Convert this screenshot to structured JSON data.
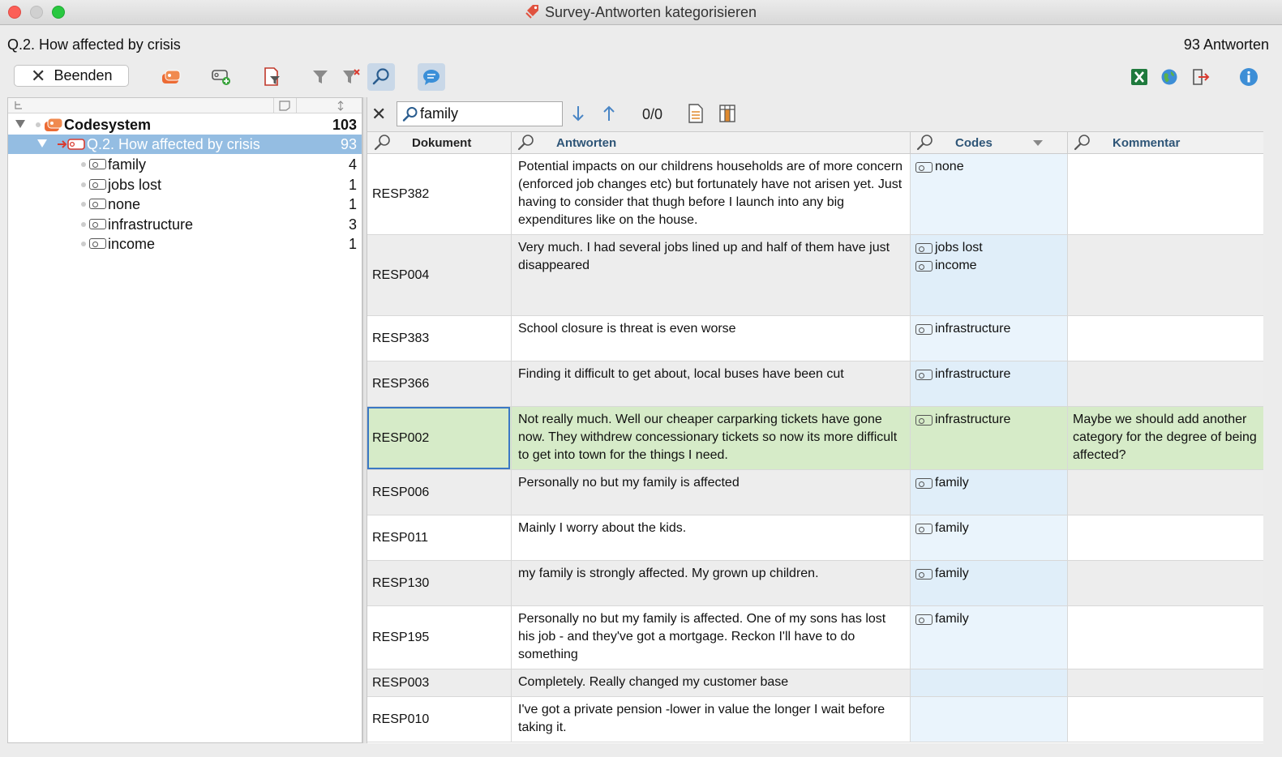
{
  "window": {
    "title": "Survey-Antworten kategorisieren"
  },
  "header": {
    "question": "Q.2. How affected by crisis",
    "answer_count": "93 Antworten"
  },
  "toolbar": {
    "quit_label": "Beenden",
    "icons": [
      "code-system-icon",
      "new-code-icon",
      "filter-document-icon",
      "filter-icon",
      "clear-filter-icon",
      "search-icon",
      "comment-icon",
      "excel-export-icon",
      "web-export-icon",
      "exit-export-icon",
      "info-icon"
    ]
  },
  "tree": {
    "root": {
      "label": "Codesystem",
      "count": "103"
    },
    "question": {
      "label": "Q.2. How affected by crisis",
      "count": "93"
    },
    "codes": [
      {
        "label": "family",
        "count": "4"
      },
      {
        "label": "jobs lost",
        "count": "1"
      },
      {
        "label": "none",
        "count": "1"
      },
      {
        "label": "infrastructure",
        "count": "3"
      },
      {
        "label": "income",
        "count": "1"
      }
    ]
  },
  "search": {
    "value": "family",
    "hits": "0/0"
  },
  "table": {
    "columns": {
      "doc": "Dokument",
      "answers": "Antworten",
      "codes": "Codes",
      "comment": "Kommentar"
    },
    "rows": [
      {
        "doc": "RESP382",
        "answer": "Potential impacts on our childrens households are of more concern (enforced job changes etc) but fortunately have not arisen yet. Just having to consider that thugh before I launch into any big expenditures like on the house.",
        "codes": [
          "none"
        ],
        "comment": ""
      },
      {
        "doc": "RESP004",
        "answer": "Very much. I had several jobs lined up and half of them have just disappeared",
        "codes": [
          "jobs lost",
          "income"
        ],
        "comment": ""
      },
      {
        "doc": "RESP383",
        "answer": "School closure is threat is even worse",
        "codes": [
          "infrastructure"
        ],
        "comment": ""
      },
      {
        "doc": "RESP366",
        "answer": "Finding it difficult to get about, local buses have been cut",
        "codes": [
          "infrastructure"
        ],
        "comment": ""
      },
      {
        "doc": "RESP002",
        "answer": "Not really much. Well our cheaper carparking tickets have gone now. They withdrew concessionary tickets so now its more difficult to get into town for the things I need.",
        "codes": [
          "infrastructure"
        ],
        "comment": "Maybe we should add another category for the degree of being affected?"
      },
      {
        "doc": "RESP006",
        "answer": "Personally no but my family is affected",
        "codes": [
          "family"
        ],
        "comment": ""
      },
      {
        "doc": "RESP011",
        "answer": "Mainly I worry about the kids.",
        "codes": [
          "family"
        ],
        "comment": ""
      },
      {
        "doc": "RESP130",
        "answer": "my family is strongly affected. My grown up children.",
        "codes": [
          "family"
        ],
        "comment": ""
      },
      {
        "doc": "RESP195",
        "answer": "Personally no but my family is affected. One of my sons has lost his job - and they've got a mortgage. Reckon I'll have to do something",
        "codes": [
          "family"
        ],
        "comment": ""
      },
      {
        "doc": "RESP003",
        "answer": "Completely. Really changed my customer base",
        "codes": [],
        "comment": ""
      },
      {
        "doc": "RESP010",
        "answer": "I've got a private  pension -lower in value the longer I wait before taking it.",
        "codes": [],
        "comment": ""
      }
    ]
  }
}
